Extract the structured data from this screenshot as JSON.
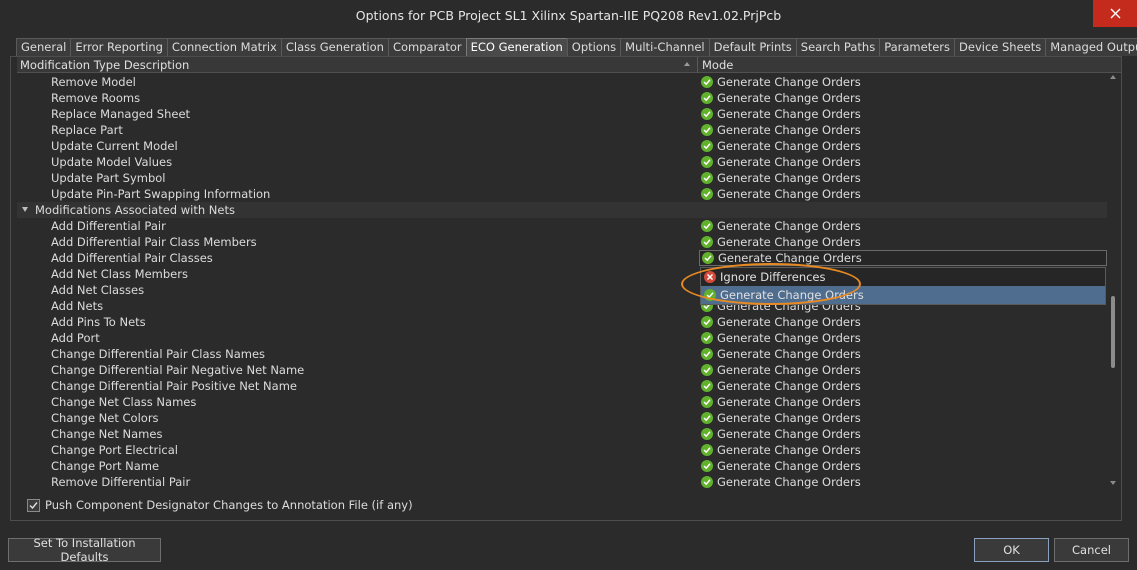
{
  "window": {
    "title": "Options for PCB Project SL1 Xilinx Spartan-IIE PQ208 Rev1.02.PrjPcb"
  },
  "tabs": [
    {
      "label": "General"
    },
    {
      "label": "Error Reporting"
    },
    {
      "label": "Connection Matrix"
    },
    {
      "label": "Class Generation"
    },
    {
      "label": "Comparator"
    },
    {
      "label": "ECO Generation",
      "active": true
    },
    {
      "label": "Options"
    },
    {
      "label": "Multi-Channel"
    },
    {
      "label": "Default Prints"
    },
    {
      "label": "Search Paths"
    },
    {
      "label": "Parameters"
    },
    {
      "label": "Device Sheets"
    },
    {
      "label": "Managed OutputJobs"
    }
  ],
  "grid": {
    "header": {
      "description": "Modification Type Description",
      "mode": "Mode"
    },
    "rows": [
      {
        "desc": "Remove Model",
        "mode": "Generate Change Orders"
      },
      {
        "desc": "Remove Rooms",
        "mode": "Generate Change Orders"
      },
      {
        "desc": "Replace Managed Sheet",
        "mode": "Generate Change Orders"
      },
      {
        "desc": "Replace Part",
        "mode": "Generate Change Orders"
      },
      {
        "desc": "Update Current Model",
        "mode": "Generate Change Orders"
      },
      {
        "desc": "Update Model Values",
        "mode": "Generate Change Orders"
      },
      {
        "desc": "Update Part Symbol",
        "mode": "Generate Change Orders"
      },
      {
        "desc": "Update Pin-Part Swapping Information",
        "mode": "Generate Change Orders"
      },
      {
        "desc": "Modifications Associated with Nets",
        "mode": "",
        "group": true
      },
      {
        "desc": "Add Differential Pair",
        "mode": "Generate Change Orders"
      },
      {
        "desc": "Add Differential Pair Class Members",
        "mode": "Generate Change Orders"
      },
      {
        "desc": "Add Differential Pair Classes",
        "mode": "Generate Change Orders",
        "editing": true
      },
      {
        "desc": "Add Net Class Members",
        "mode": ""
      },
      {
        "desc": "Add Net Classes",
        "mode": ""
      },
      {
        "desc": "Add Nets",
        "mode": "Generate Change Orders"
      },
      {
        "desc": "Add Pins To Nets",
        "mode": "Generate Change Orders"
      },
      {
        "desc": "Add Port",
        "mode": "Generate Change Orders"
      },
      {
        "desc": "Change Differential Pair Class Names",
        "mode": "Generate Change Orders"
      },
      {
        "desc": "Change Differential Pair Negative Net Name",
        "mode": "Generate Change Orders"
      },
      {
        "desc": "Change Differential Pair Positive Net Name",
        "mode": "Generate Change Orders"
      },
      {
        "desc": "Change Net Class Names",
        "mode": "Generate Change Orders"
      },
      {
        "desc": "Change Net Colors",
        "mode": "Generate Change Orders"
      },
      {
        "desc": "Change Net Names",
        "mode": "Generate Change Orders"
      },
      {
        "desc": "Change Port Electrical",
        "mode": "Generate Change Orders"
      },
      {
        "desc": "Change Port Name",
        "mode": "Generate Change Orders"
      },
      {
        "desc": "Remove Differential Pair",
        "mode": "Generate Change Orders"
      }
    ]
  },
  "dropdown": {
    "options": [
      {
        "label": "Ignore Differences",
        "icon": "ignore-icon"
      },
      {
        "label": "Generate Change Orders",
        "icon": "check-icon",
        "selected": true
      }
    ]
  },
  "checkbox": {
    "label": "Push Component Designator Changes to Annotation File (if any)",
    "checked": true
  },
  "buttons": {
    "defaults": "Set To Installation Defaults",
    "ok": "OK",
    "cancel": "Cancel"
  },
  "colors": {
    "accent_selection": "#4f6d8f",
    "ok_green": "#62b12d",
    "ignore_red": "#d24a3a",
    "highlight_orange": "#e88a23",
    "close_red": "#c42b1c"
  }
}
